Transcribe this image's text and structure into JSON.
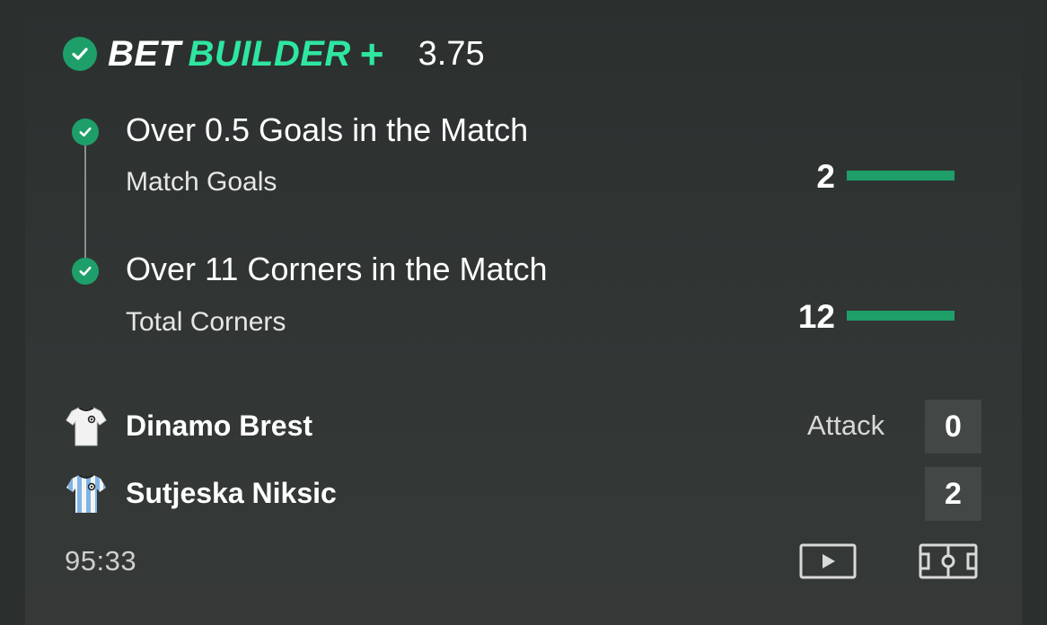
{
  "header": {
    "brand_bet": "BET",
    "brand_builder": "BUILDER",
    "plus": "+",
    "odds": "3.75"
  },
  "legs": [
    {
      "title": "Over 0.5 Goals in the Match",
      "subtitle": "Match Goals",
      "value": "2",
      "status": "won"
    },
    {
      "title": "Over 11 Corners in the Match",
      "subtitle": "Total Corners",
      "value": "12",
      "status": "won"
    }
  ],
  "match": {
    "home_team": "Dinamo Brest",
    "away_team": "Sutjeska Niksic",
    "score_label": "Attack",
    "home_score": "0",
    "away_score": "2",
    "clock": "95:33"
  },
  "icons": {
    "check": "check-circle-icon",
    "play": "play-icon",
    "pitch": "pitch-icon",
    "home_shirt": "white-shirt-icon",
    "away_shirt": "striped-shirt-icon"
  },
  "colors": {
    "accent": "#2ee6a0",
    "success": "#1e9f6a",
    "card_bg": "#2f3433",
    "score_bg": "#434746"
  }
}
